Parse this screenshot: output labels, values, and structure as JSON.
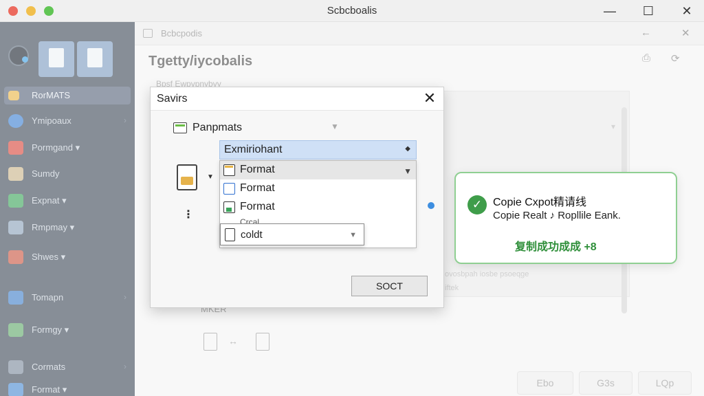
{
  "window": {
    "title": "Scbcboalis",
    "minimize_glyph": "—",
    "maximize_glyph": "☐",
    "close_glyph": "✕"
  },
  "sidebar": {
    "items": [
      {
        "label": "RorMATS",
        "icon": "folder-icon",
        "color": "#e8b546",
        "active": true
      },
      {
        "label": "Ymipoaux",
        "icon": "app-icon",
        "color": "#3a7fd0"
      },
      {
        "label": "Pormgand ▾",
        "icon": "format-icon",
        "color": "#d7463a"
      },
      {
        "label": "Sumdy",
        "icon": "image-icon",
        "color": "#c9b48a"
      },
      {
        "label": "Expnat ▾",
        "icon": "export-icon",
        "color": "#3aa35a"
      },
      {
        "label": "Rmpmay ▾",
        "icon": "grid-icon",
        "color": "#8aa0b8"
      },
      {
        "label": "Shwes ▾",
        "icon": "shapes-icon",
        "color": "#c8553f"
      },
      {
        "label": "Tomapn",
        "icon": "doc-icon",
        "color": "#3f7fc8"
      },
      {
        "label": "Formgy ▾",
        "icon": "table-icon",
        "color": "#5fa86a"
      },
      {
        "label": "Cormats",
        "icon": "chart-icon",
        "color": "#7b8a9c"
      },
      {
        "label": "Format ▾",
        "icon": "file-icon",
        "color": "#4a8ad0"
      }
    ]
  },
  "main": {
    "tab_label": "Bcbcpodis",
    "title": "Tgetty/iycobalis",
    "ghost_row_label": "MKER",
    "ghost_text_1": "Bpsf Ewpvpnybvy",
    "ghost_text_2": "ovosbpah iosbe psoeqge",
    "ghost_text_3": "iftek",
    "bottom_buttons": [
      "Ebo",
      "G3s",
      "LQp"
    ]
  },
  "dialog": {
    "title": "Savirs",
    "close_glyph": "✕",
    "path_label": "Panpmats",
    "combo_value": "Exmiriohant",
    "options": [
      "Format",
      "Format",
      "Format"
    ],
    "option_sub": "Crcal",
    "sub_value": "coldt",
    "button_label": "SOCT"
  },
  "toast": {
    "line1": "Copie Cxpot精请线",
    "line2": "Copie Realt ♪ Ropllile Eank.",
    "line3": "复制成功成成 +8",
    "accent_color": "#3f9d4a"
  }
}
